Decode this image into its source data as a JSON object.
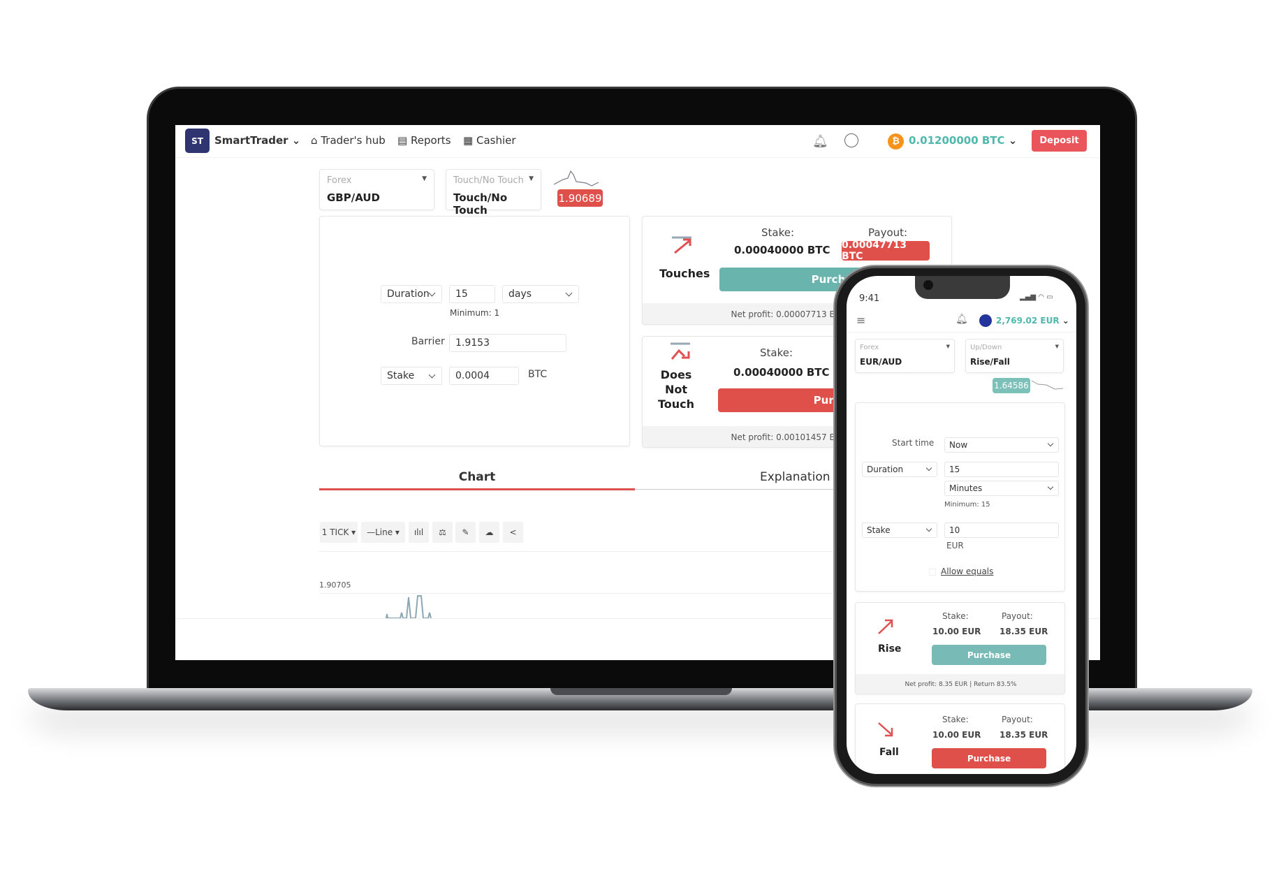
{
  "laptop": {
    "nav": {
      "logo": "ST",
      "app_name": "SmartTrader",
      "links": [
        "Trader's hub",
        "Reports",
        "Cashier"
      ],
      "balance": "0.01200000 BTC",
      "deposit": "Deposit"
    },
    "market": {
      "category": "Forex",
      "value": "GBP/AUD"
    },
    "trade_type": {
      "category": "Touch/No Touch",
      "value": "Touch/No Touch"
    },
    "spot_price": "1.90689",
    "form": {
      "duration_label": "Duration",
      "duration_value": "15",
      "duration_unit": "days",
      "minimum": "Minimum: 1",
      "barrier_label": "Barrier",
      "barrier_value": "1.9153",
      "stake_label": "Stake",
      "stake_value": "0.0004",
      "currency": "BTC"
    },
    "contracts": [
      {
        "name": "Touches",
        "stake_label": "Stake:",
        "stake": "0.00040000 BTC",
        "payout_label": "Payout:",
        "payout": "0.00047713 BTC",
        "button": "Purcha",
        "net_profit": "Net profit: 0.00007713 BTC | Re"
      },
      {
        "name_lines": [
          "Does",
          "Not",
          "Touch"
        ],
        "stake_label": "Stake:",
        "stake": "0.00040000 BTC",
        "button": "Purch",
        "net_profit": "Net profit: 0.00101457 BTC | Re"
      }
    ],
    "tabs": [
      "Chart",
      "Explanation"
    ],
    "chart_toolbar": {
      "interval": "1 TICK",
      "chart_type": "Line"
    },
    "chart_price_label": "1.90705"
  },
  "phone": {
    "time": "9:41",
    "balance": "2,769.02 EUR",
    "market": {
      "category": "Forex",
      "value": "EUR/AUD"
    },
    "trade_type": {
      "category": "Up/Down",
      "value": "Rise/Fall"
    },
    "spot_price": "1.64586",
    "form": {
      "start_time_label": "Start time",
      "start_time": "Now",
      "duration_label": "Duration",
      "duration_value": "15",
      "duration_unit": "Minutes",
      "minimum": "Minimum: 15",
      "stake_label": "Stake",
      "stake_value": "10",
      "currency": "EUR",
      "allow_equals": "Allow equals"
    },
    "contracts": [
      {
        "name": "Rise",
        "stake_label": "Stake:",
        "stake": "10.00 EUR",
        "payout_label": "Payout:",
        "payout": "18.35 EUR",
        "button": "Purchase",
        "net_profit": "Net profit: 8.35 EUR | Return 83.5%"
      },
      {
        "name": "Fall",
        "stake_label": "Stake:",
        "stake": "10.00 EUR",
        "payout_label": "Payout:",
        "payout": "18.35 EUR",
        "button": "Purchase"
      }
    ]
  },
  "colors": {
    "accent_green": "#6ab4ae",
    "accent_red": "#e0504a",
    "balance_teal": "#4fb8ad",
    "logo_navy": "#2e3570",
    "btc_orange": "#f7931a"
  }
}
